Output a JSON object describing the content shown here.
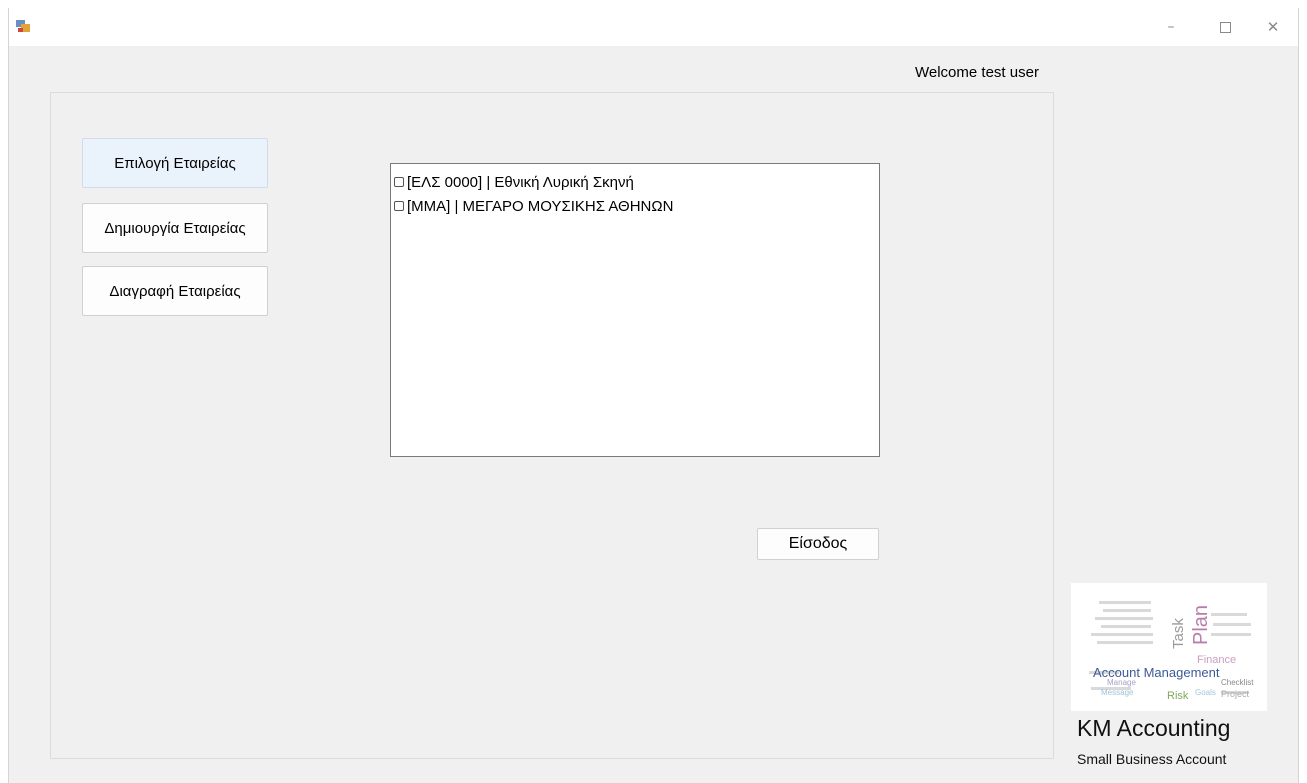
{
  "window": {
    "controls": {
      "minimize": "–",
      "close": "✕"
    }
  },
  "header": {
    "welcome": "Welcome test user"
  },
  "sidebar": {
    "buttons": [
      {
        "label": "Επιλογή Εταιρείας",
        "active": true
      },
      {
        "label": "Δημιουργία Εταιρείας",
        "active": false
      },
      {
        "label": "Διαγραφή Εταιρείας",
        "active": false
      }
    ]
  },
  "company_list": {
    "items": [
      {
        "label": "[ΕΛΣ 0000] | Εθνική Λυρική Σκηνή",
        "checked": false
      },
      {
        "label": "[ΜΜΑ] | ΜΕΓΑΡΟ ΜΟΥΣΙΚΗΣ ΑΘΗΝΩΝ",
        "checked": false
      }
    ]
  },
  "actions": {
    "enter_label": "Είσοδος"
  },
  "logo": {
    "words": [
      "Account Management",
      "Task",
      "Plan",
      "Finance",
      "Checklist",
      "Goals",
      "Project",
      "Risk",
      "Manage",
      "Message"
    ],
    "icon": "word-cloud-logo"
  },
  "branding": {
    "name": "KM Accounting",
    "tagline": "Small Business Account"
  },
  "colors": {
    "form_background": "#f0f0f0",
    "active_button": "#eaf3fc",
    "list_border": "#7a7a7a"
  }
}
